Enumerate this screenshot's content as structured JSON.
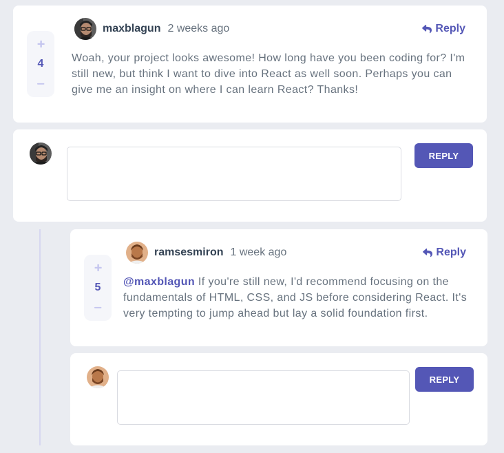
{
  "colors": {
    "page_bg": "#eaecf1",
    "card_bg": "#ffffff",
    "accent": "#5457b6",
    "accent_light": "#c5c6ef",
    "vote_bg": "#f5f6fa",
    "heading": "#334253",
    "body_text": "#67727e",
    "thread_line": "#d6d7f0"
  },
  "icons": {
    "upvote": "plus-icon",
    "downvote": "minus-icon",
    "reply": "reply-icon"
  },
  "comment": {
    "score": 4,
    "avatar": "avatar-maxblagun-icon",
    "username": "maxblagun",
    "created_at": "2 weeks ago",
    "reply_label": "Reply",
    "content": "Woah, your project looks awesome! How long have you been coding for? I'm still new, but think I want to dive into React as well soon. Perhaps you can give me an insight on where I can learn React? Thanks!"
  },
  "comment_reply_form": {
    "avatar": "avatar-maxblagun-icon",
    "submit_label": "REPLY"
  },
  "reply": {
    "score": 5,
    "avatar": "avatar-ramsesmiron-icon",
    "username": "ramsesmiron",
    "created_at": "1 week ago",
    "reply_label": "Reply",
    "replying_to": "@maxblagun",
    "content": "If you're still new, I'd recommend focusing on the fundamentals of HTML, CSS, and JS before considering React. It's very tempting to jump ahead but lay a solid foundation first."
  },
  "reply_reply_form": {
    "avatar": "avatar-ramsesmiron-icon",
    "submit_label": "REPLY"
  }
}
